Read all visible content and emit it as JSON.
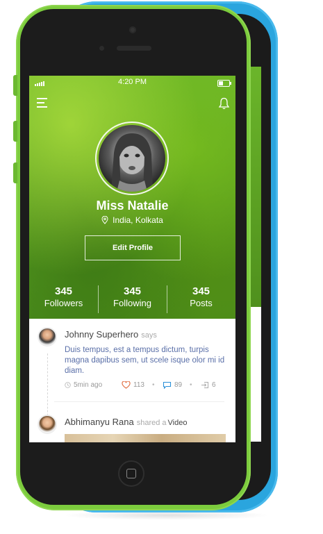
{
  "status_bar": {
    "time": "4:20 PM"
  },
  "profile": {
    "name": "Miss Natalie",
    "location": "India, Kolkata",
    "edit_label": "Edit Profile"
  },
  "stats": [
    {
      "value": "345",
      "label": "Followers"
    },
    {
      "value": "345",
      "label": "Following"
    },
    {
      "value": "345",
      "label": "Posts"
    }
  ],
  "posts": [
    {
      "author": "Johnny Superhero",
      "verb": "says",
      "text": "Duis tempus, est a tempus dictum, turpis magna dapibus sem, ut scele isque olor mi id diam.",
      "time": "5min ago",
      "likes": "113",
      "comments": "89",
      "shares": "6"
    },
    {
      "author": "Abhimanyu Rana",
      "verb": "shared a",
      "object": "Video"
    }
  ],
  "colors": {
    "phone_front": "#7ccc3d",
    "phone_back": "#2aa5de",
    "like": "#e0683a",
    "comment": "#2a8fd8",
    "post_text": "#5a6fa8"
  },
  "icons": {
    "menu": "hamburger-icon",
    "notifications": "bell-icon",
    "location": "pin-icon",
    "time": "clock-icon",
    "like": "heart-icon",
    "comment": "speech-bubble-icon",
    "share": "share-arrow-icon"
  }
}
